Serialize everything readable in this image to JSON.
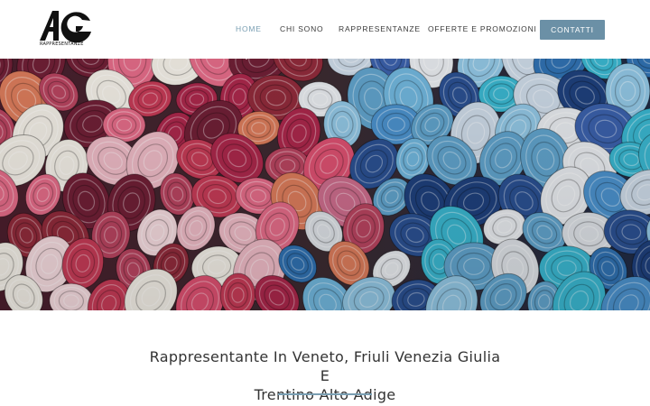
{
  "brand": {
    "logo_mark": "AG",
    "logo_subtitle": "RAPPRESENTANZE",
    "accent": "#7a9fb3",
    "button_color": "#6b90a6"
  },
  "nav": {
    "items": [
      {
        "label": "HOME",
        "active": true
      },
      {
        "label": "CHI SONO",
        "active": false
      },
      {
        "label": "RAPPRESENTANZE",
        "active": false
      },
      {
        "label": "OFFERTE E PROMOZIONI",
        "active": false
      }
    ],
    "cta_label": "CONTATTI"
  },
  "hero": {
    "image_subject": "rolled fabric bolts"
  },
  "main": {
    "headline_line1": "Rappresentante In Veneto, Friuli Venezia Giulia E",
    "headline_line2": "Trentino Alto Adige"
  }
}
